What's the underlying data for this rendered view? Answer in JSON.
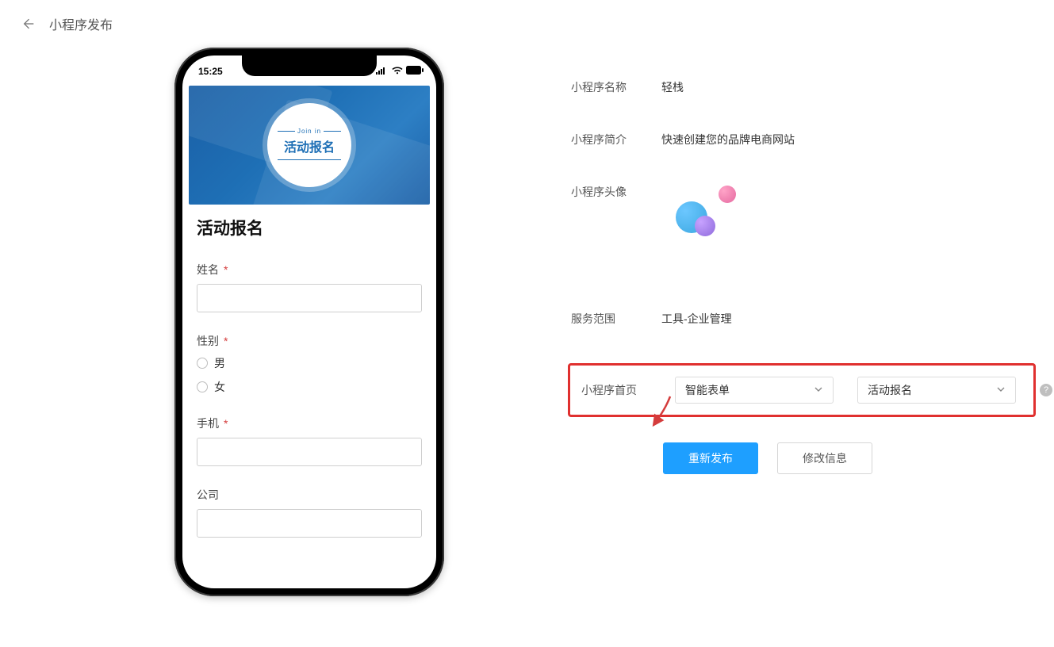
{
  "header": {
    "title": "小程序发布"
  },
  "preview": {
    "time": "15:25",
    "banner": {
      "join": "Join in",
      "title": "活动报名"
    },
    "form": {
      "heading": "活动报名",
      "fields": {
        "name": {
          "label": "姓名"
        },
        "gender": {
          "label": "性别",
          "options": [
            "男",
            "女"
          ]
        },
        "phone": {
          "label": "手机"
        },
        "company": {
          "label": "公司"
        }
      }
    }
  },
  "info": {
    "rows": {
      "name": {
        "label": "小程序名称",
        "value": "轻栈"
      },
      "desc": {
        "label": "小程序简介",
        "value": "快速创建您的品牌电商网站"
      },
      "avatar": {
        "label": "小程序头像"
      },
      "scope": {
        "label": "服务范围",
        "value": "工具-企业管理"
      },
      "homepage": {
        "label": "小程序首页",
        "select1": "智能表单",
        "select2": "活动报名"
      }
    }
  },
  "actions": {
    "republish": "重新发布",
    "editinfo": "修改信息"
  }
}
